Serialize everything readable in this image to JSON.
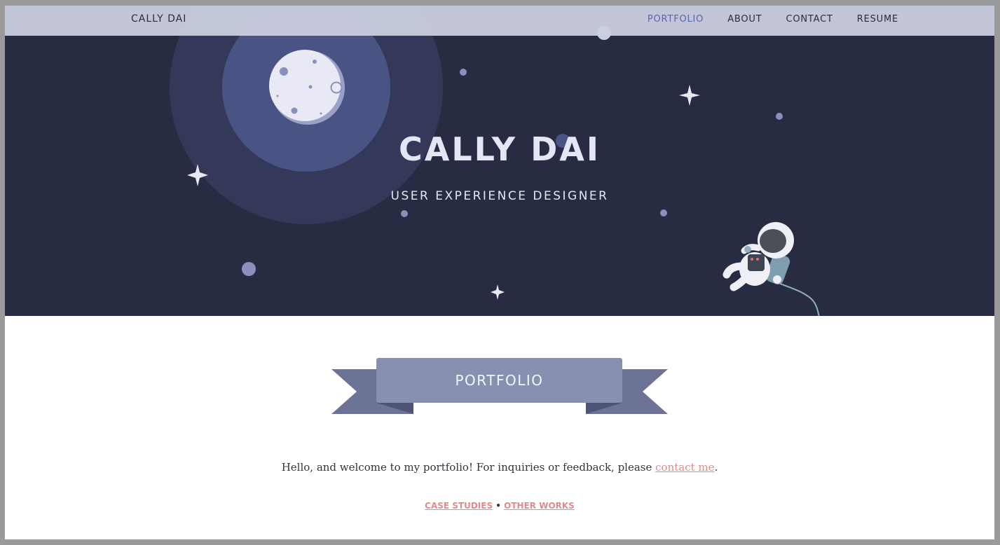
{
  "nav": {
    "brand": "CALLY DAI",
    "links": [
      {
        "label": "PORTFOLIO",
        "active": true
      },
      {
        "label": "ABOUT",
        "active": false
      },
      {
        "label": "CONTACT",
        "active": false
      },
      {
        "label": "RESUME",
        "active": false
      }
    ]
  },
  "hero": {
    "title": "CALLY DAI",
    "subtitle": "USER EXPERIENCE DESIGNER"
  },
  "section": {
    "banner_label": "PORTFOLIO",
    "welcome_prefix": "Hello, and welcome to my portfolio! For inquiries or feedback, please ",
    "welcome_link": "contact me",
    "welcome_suffix": ".",
    "case_studies_link": "CASE STUDIES",
    "separator": "•",
    "other_works_link": "OTHER WORKS"
  },
  "colors": {
    "hero_bg": "#282c42",
    "nav_bg": "#cbcfe2",
    "nav_active": "#5a64a8",
    "link_accent": "#e48a8a",
    "banner_main": "#8790b0",
    "banner_tail": "#6c7396"
  }
}
